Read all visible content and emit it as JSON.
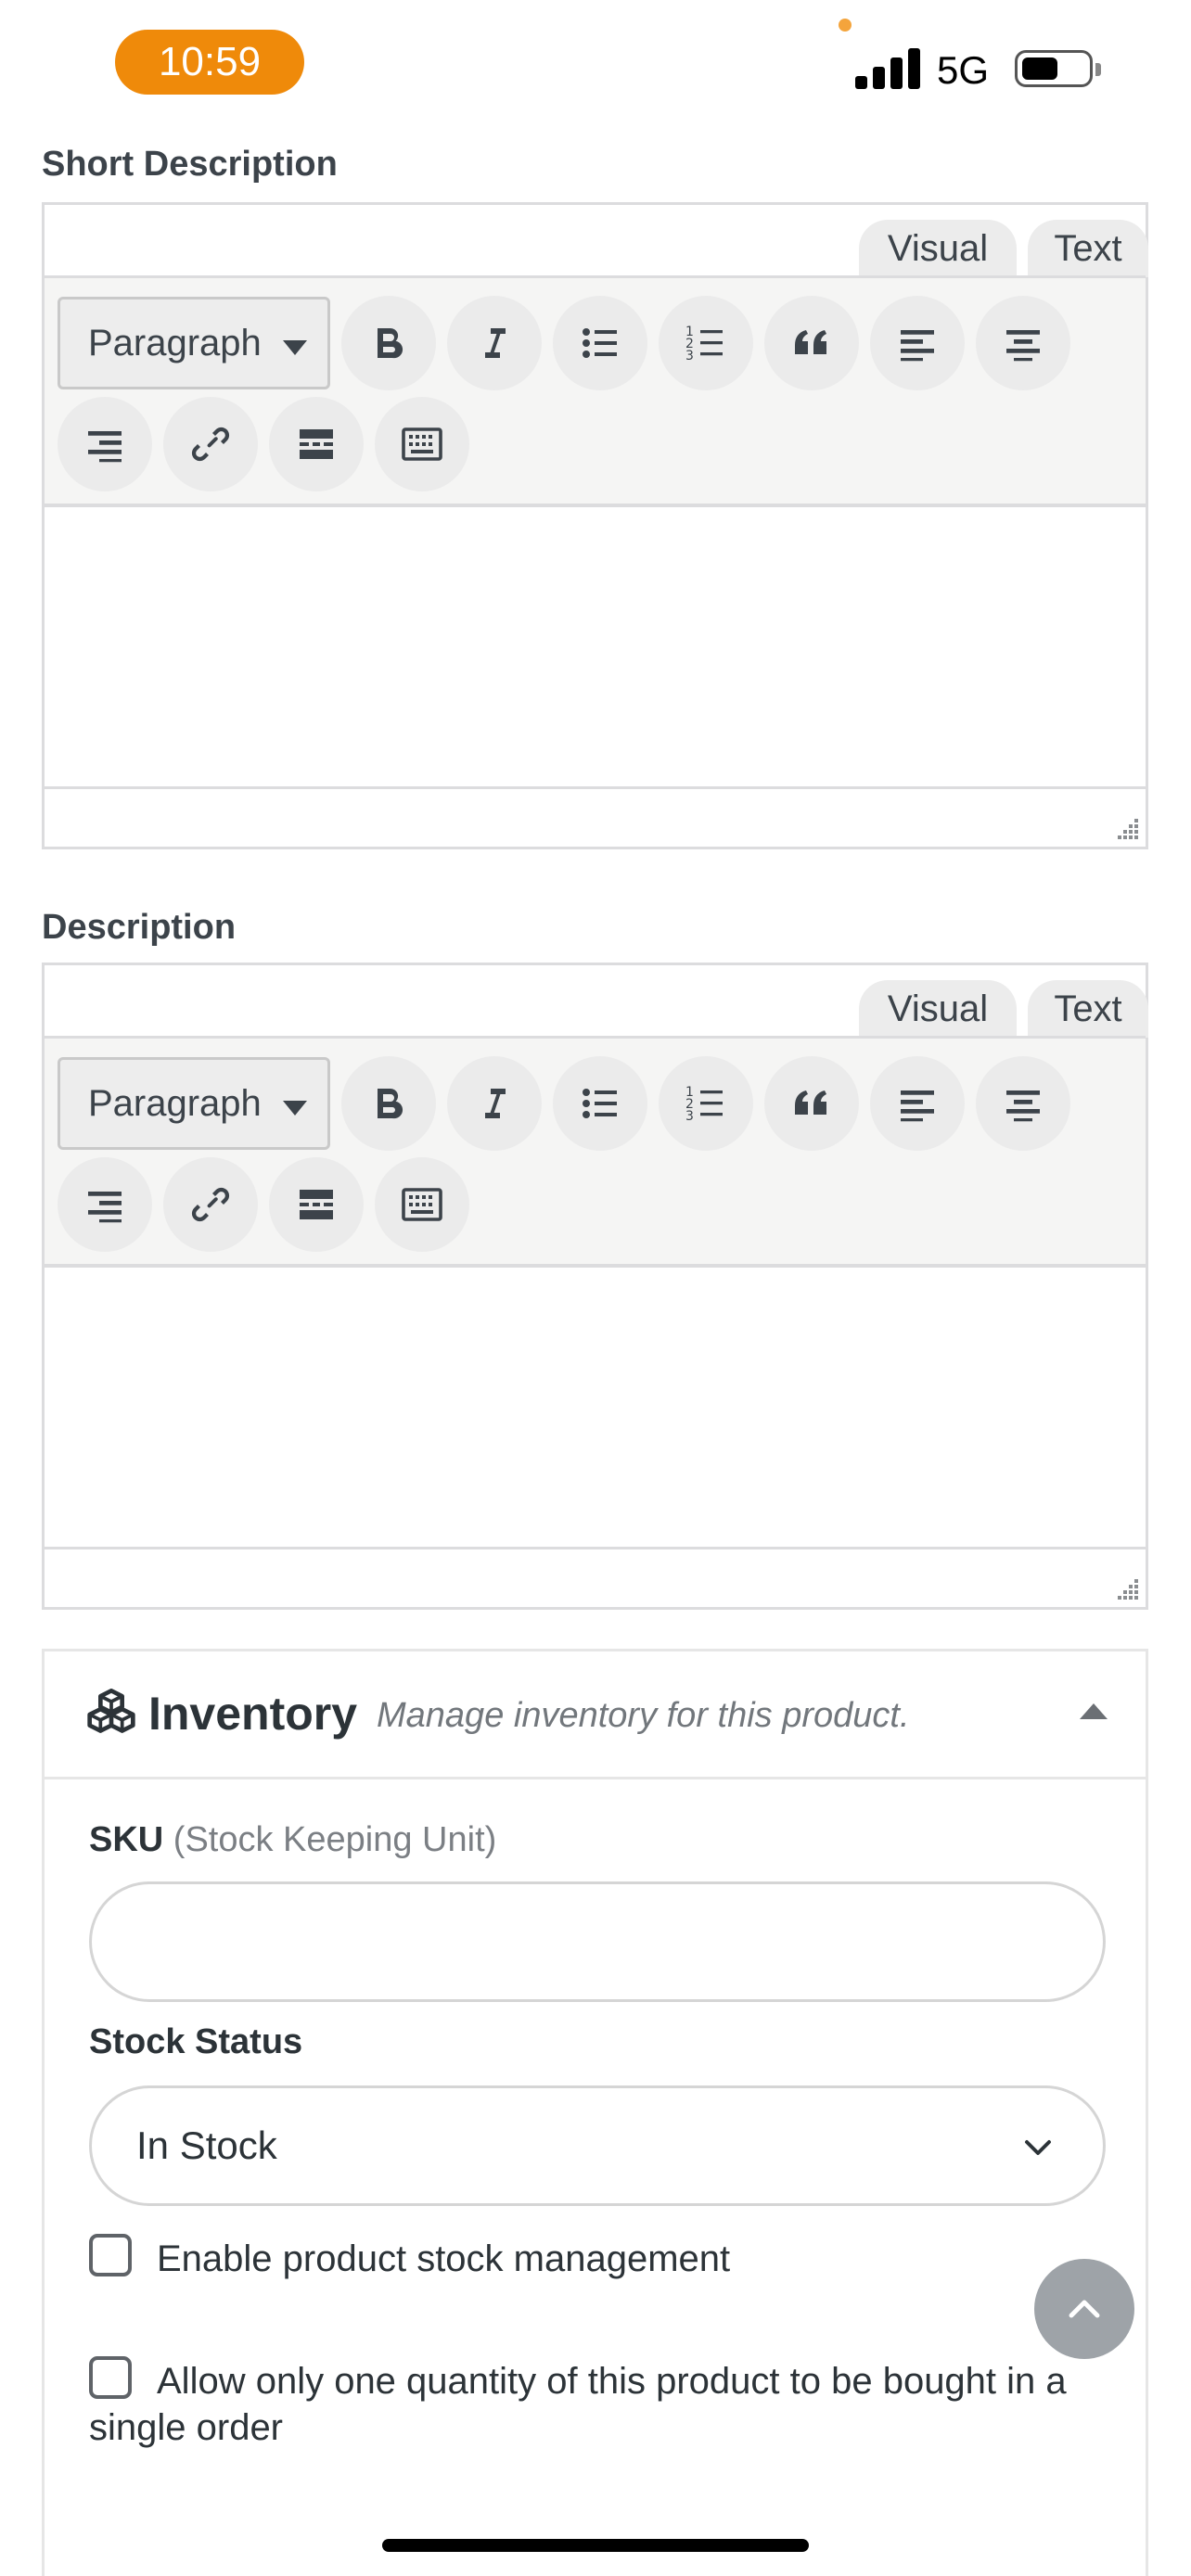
{
  "status_bar": {
    "time": "10:59",
    "network": "5G",
    "time_pill_color": "#ef8a0a"
  },
  "short_description": {
    "heading": "Short Description",
    "tab_visual": "Visual",
    "tab_text": "Text",
    "format": "Paragraph"
  },
  "description": {
    "heading": "Description",
    "tab_visual": "Visual",
    "tab_text": "Text",
    "format": "Paragraph"
  },
  "toolbar_icons": [
    "bold-icon",
    "italic-icon",
    "bulleted-list-icon",
    "numbered-list-icon",
    "blockquote-icon",
    "align-left-icon",
    "align-center-icon",
    "align-right-icon",
    "link-icon",
    "read-more-icon",
    "toolbar-toggle-icon"
  ],
  "inventory": {
    "title": "Inventory",
    "description": "Manage inventory for this product.",
    "sku_label": "SKU",
    "sku_hint": "(Stock Keeping Unit)",
    "sku_value": "",
    "stock_status_label": "Stock Status",
    "stock_status_value": "In Stock",
    "manage_stock_label": "Enable product stock management",
    "manage_stock_checked": false,
    "sold_individually_label": "Allow only one quantity of this product to be bought in a single order",
    "sold_individually_checked": false
  }
}
